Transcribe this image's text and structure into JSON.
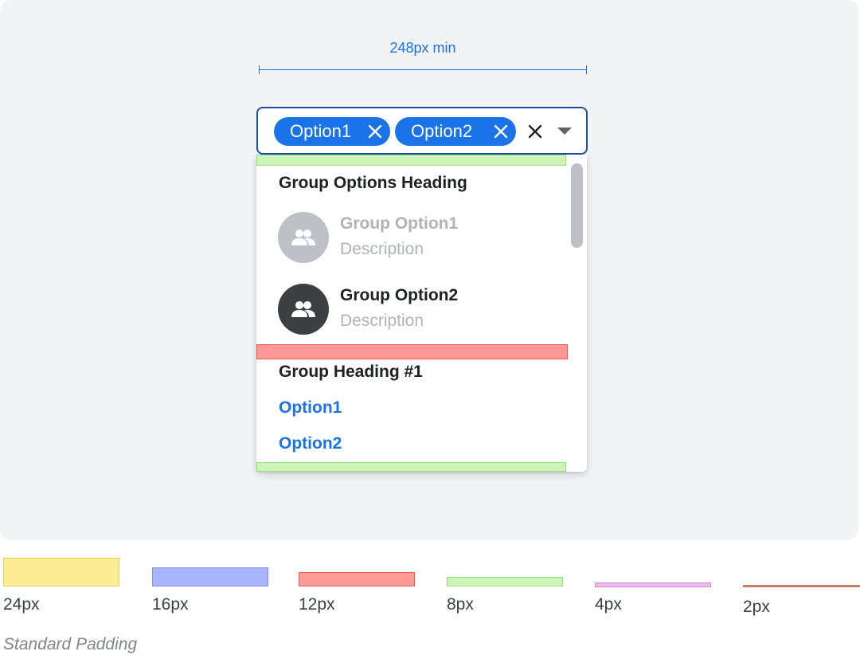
{
  "dimension": {
    "label": "248px min"
  },
  "field": {
    "chips": [
      {
        "label": "Option1",
        "remove_icon": "close-icon"
      },
      {
        "label": "Option2",
        "remove_icon": "close-icon"
      }
    ],
    "clear_icon": "close-icon",
    "dropdown_icon": "caret-down-icon"
  },
  "dropdown": {
    "group_with_avatars": {
      "heading": "Group Options Heading",
      "options": [
        {
          "title": "Group Option1",
          "description": "Description",
          "state": "disabled",
          "icon": "group-icon"
        },
        {
          "title": "Group Option2",
          "description": "Description",
          "state": "enabled",
          "icon": "group-icon"
        }
      ]
    },
    "group_1": {
      "heading": "Group Heading #1",
      "options": [
        "Option1",
        "Option2"
      ]
    }
  },
  "legend": {
    "items": [
      {
        "label": "24px",
        "color": "#fdee96"
      },
      {
        "label": "16px",
        "color": "#aab5fb"
      },
      {
        "label": "12px",
        "color": "#ff9a94"
      },
      {
        "label": "8px",
        "color": "#ccf5b8"
      },
      {
        "label": "4px",
        "color": "#f4b6ee"
      },
      {
        "label": "2px",
        "color": "#c8806a"
      }
    ],
    "caption": "Standard Padding"
  },
  "colors": {
    "accent": "#1a73e8",
    "field_border": "#1a4fa3",
    "canvas_bg": "#f1f3f4"
  }
}
